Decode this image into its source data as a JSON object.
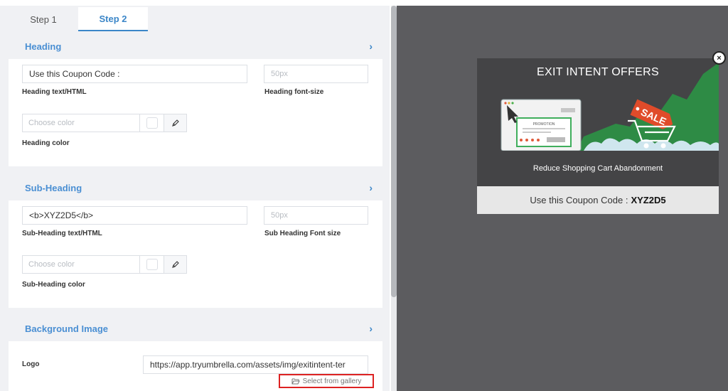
{
  "tabs": [
    {
      "label": "Step 1",
      "active": false
    },
    {
      "label": "Step 2",
      "active": true
    }
  ],
  "heading_section": {
    "title": "Heading",
    "text_value": "Use this Coupon Code :",
    "text_label": "Heading text/HTML",
    "size_placeholder": "50px",
    "size_label": "Heading font-size",
    "color_placeholder": "Choose color",
    "color_label": "Heading color"
  },
  "subheading_section": {
    "title": "Sub-Heading",
    "text_value": "<b>XYZ2D5</b>",
    "text_label": "Sub-Heading text/HTML",
    "size_placeholder": "50px",
    "size_label": "Sub Heading Font size",
    "color_placeholder": "Choose color",
    "color_label": "Sub-Heading color"
  },
  "background_section": {
    "title": "Background Image",
    "logo_label": "Logo",
    "logo_value": "https://app.tryumbrella.com/assets/img/exitintent-ter",
    "gallery_label": "Select from gallery"
  },
  "preview": {
    "title": "EXIT INTENT OFFERS",
    "banner_promo": "PROMOTION",
    "banner_sale": "SALE",
    "subtitle": "Reduce Shopping Cart Abandonment",
    "coupon_prefix": "Use this Coupon Code :",
    "coupon_code": "XYZ2D5",
    "close_symbol": "×"
  },
  "colors": {
    "accent": "#3b86c8",
    "preview_bg": "#5c5c5f",
    "popup_dark": "#444446",
    "sale_red": "#e04b2a",
    "chart_green": "#2e8b45",
    "gallery_border": "#dd2222"
  },
  "icons": [
    "chevron-right-icon",
    "pencil-icon",
    "folder-open-icon",
    "close-icon",
    "cursor-arrow-icon",
    "shopping-cart-icon"
  ]
}
